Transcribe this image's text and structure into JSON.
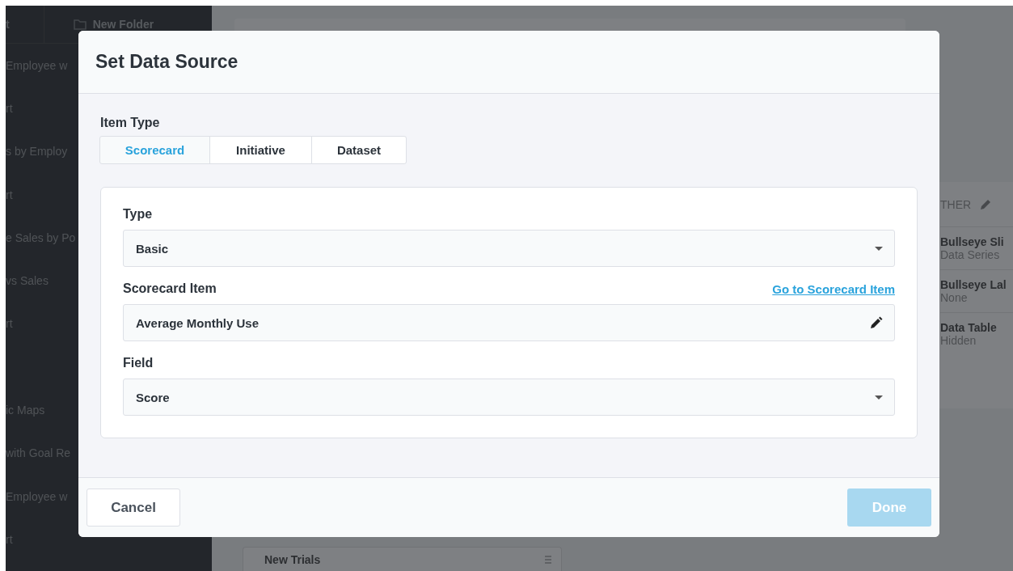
{
  "background": {
    "toolbar": {
      "button_1": "t",
      "new_folder": "New Folder"
    },
    "sidebar": {
      "items": [
        "Employee w",
        "rt",
        "s by Employ",
        "rt",
        "e Sales by Po",
        "vs Sales",
        "rt",
        "ic Maps",
        "with Goal Re",
        "Employee w",
        "rt"
      ]
    },
    "properties": {
      "section": "THER",
      "rows": [
        {
          "name": "Bullseye Sli",
          "value": "Data Series"
        },
        {
          "name": "Bullseye Lal",
          "value": "None"
        },
        {
          "name": "Data Table",
          "value": "Hidden"
        }
      ]
    },
    "card_title": "New Trials"
  },
  "dialog": {
    "title": "Set Data Source",
    "item_type_label": "Item Type",
    "tabs": [
      {
        "label": "Scorecard",
        "selected": true
      },
      {
        "label": "Initiative",
        "selected": false
      },
      {
        "label": "Dataset",
        "selected": false
      }
    ],
    "fields": [
      {
        "kind": "select",
        "label": "Type",
        "value": "Basic"
      },
      {
        "kind": "edit",
        "label": "Scorecard Item",
        "link": "Go to Scorecard Item",
        "value": "Average Monthly Use"
      },
      {
        "kind": "select",
        "label": "Field",
        "value": "Score"
      }
    ],
    "buttons": [
      {
        "label": "Cancel"
      },
      {
        "label": "Done",
        "disabled": true
      }
    ]
  }
}
